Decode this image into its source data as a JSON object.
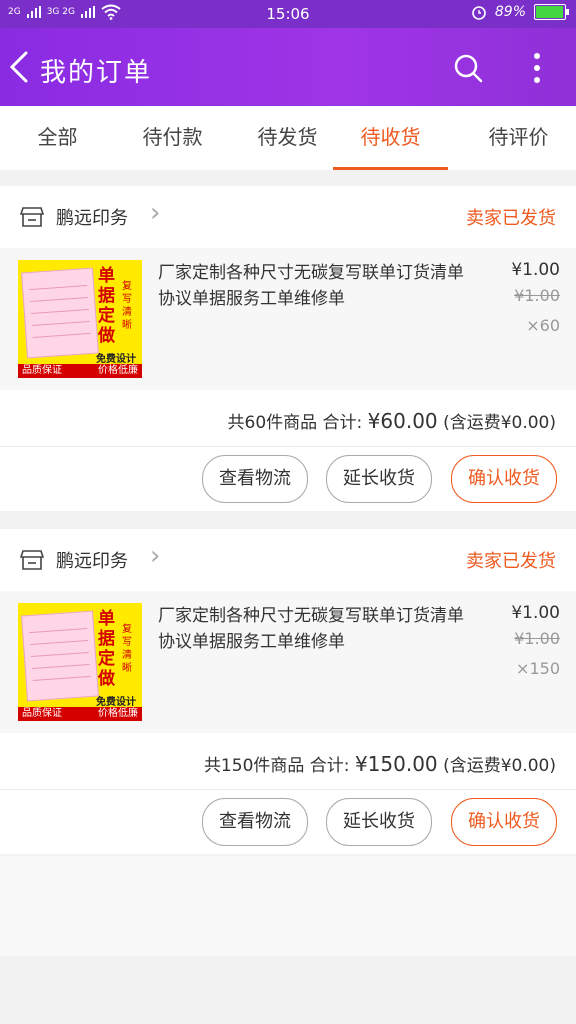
{
  "status_bar": {
    "signal1": "2G",
    "signal2": "3G 2G",
    "time": "15:06",
    "battery_percent": "89%",
    "battery_level": 0.89
  },
  "header": {
    "back_icon": "back-arrow-icon",
    "title": "我的订单",
    "search_icon": "search-icon",
    "more_icon": "more-vertical-icon"
  },
  "tabs": [
    {
      "label": "全部"
    },
    {
      "label": "待付款"
    },
    {
      "label": "待发货"
    },
    {
      "label": "待收货",
      "active": true
    },
    {
      "label": "待评价"
    }
  ],
  "colors": {
    "brand": "#9b34e3",
    "accent": "#ee5a1f"
  },
  "orders": [
    {
      "shop_name": "鹏远印务",
      "status": "卖家已发货",
      "item_title": "厂家定制各种尺寸无碳复写联单订货清单协议单据服务工单维修单",
      "price": "¥1.00",
      "original_price": "¥1.00",
      "quantity": "×60",
      "thumb": {
        "big": "单据定做",
        "small": "复写清晰",
        "free": "免费设计",
        "foot_left": "品质保证",
        "foot_right": "价格低廉"
      },
      "summary_count": "共60件商品  合计:",
      "summary_amount": "¥60.00",
      "summary_shipping": "(含运费¥0.00)",
      "buttons": {
        "logistics": "查看物流",
        "extend": "延长收货",
        "confirm": "确认收货"
      }
    },
    {
      "shop_name": "鹏远印务",
      "status": "卖家已发货",
      "item_title": "厂家定制各种尺寸无碳复写联单订货清单协议单据服务工单维修单",
      "price": "¥1.00",
      "original_price": "¥1.00",
      "quantity": "×150",
      "thumb": {
        "big": "单据定做",
        "small": "复写清晰",
        "free": "免费设计",
        "foot_left": "品质保证",
        "foot_right": "价格低廉"
      },
      "summary_count": "共150件商品  合计:",
      "summary_amount": "¥150.00",
      "summary_shipping": "(含运费¥0.00)",
      "buttons": {
        "logistics": "查看物流",
        "extend": "延长收货",
        "confirm": "确认收货"
      }
    }
  ]
}
